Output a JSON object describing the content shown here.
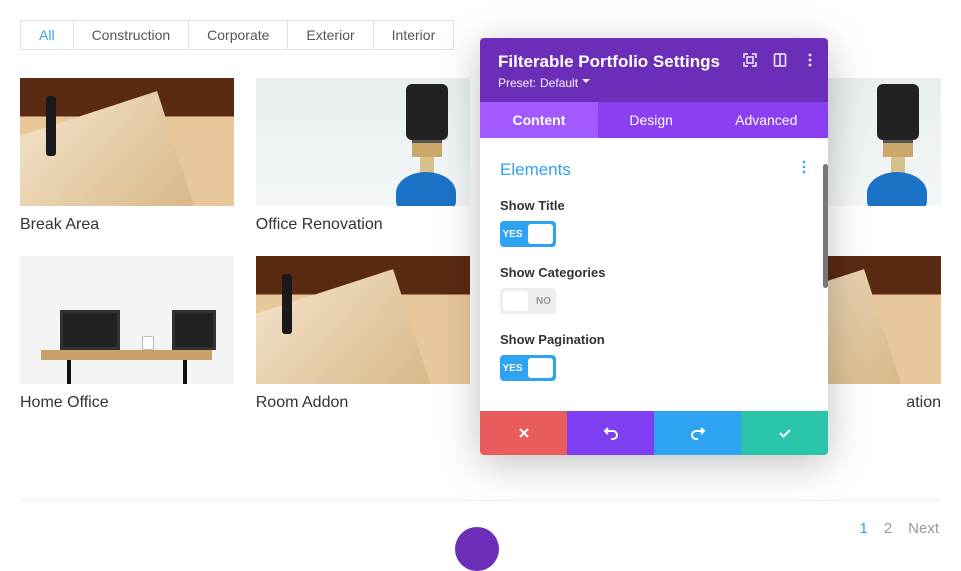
{
  "filters": {
    "items": [
      {
        "label": "All",
        "active": true
      },
      {
        "label": "Construction",
        "active": false
      },
      {
        "label": "Corporate",
        "active": false
      },
      {
        "label": "Exterior",
        "active": false
      },
      {
        "label": "Interior",
        "active": false
      }
    ]
  },
  "portfolio": {
    "items": [
      {
        "title": "Break Area",
        "kind": "wood"
      },
      {
        "title": "Office Renovation",
        "kind": "brush"
      },
      {
        "title": "",
        "kind": "hidden"
      },
      {
        "title": "",
        "kind": "brush"
      },
      {
        "title": "Home Office",
        "kind": "office"
      },
      {
        "title": "Room Addon",
        "kind": "wood"
      },
      {
        "title": "",
        "kind": "hidden"
      },
      {
        "title": "ation",
        "kind": "wood",
        "title_only_tail": true
      }
    ]
  },
  "pagination": {
    "page1": "1",
    "page2": "2",
    "next": "Next",
    "active": 1
  },
  "panel": {
    "title": "Filterable Portfolio Settings",
    "preset_label": "Preset:",
    "preset_value": "Default",
    "tabs": {
      "content": "Content",
      "design": "Design",
      "advanced": "Advanced",
      "active": "content"
    },
    "section": "Elements",
    "fields": {
      "show_title": {
        "label": "Show Title",
        "value": true,
        "on_text": "YES",
        "off_text": "NO"
      },
      "show_categories": {
        "label": "Show Categories",
        "value": false,
        "on_text": "YES",
        "off_text": "NO"
      },
      "show_pagination": {
        "label": "Show Pagination",
        "value": true,
        "on_text": "YES",
        "off_text": "NO"
      }
    },
    "actions": {
      "cancel": "cancel",
      "undo": "undo",
      "redo": "redo",
      "save": "save"
    }
  }
}
